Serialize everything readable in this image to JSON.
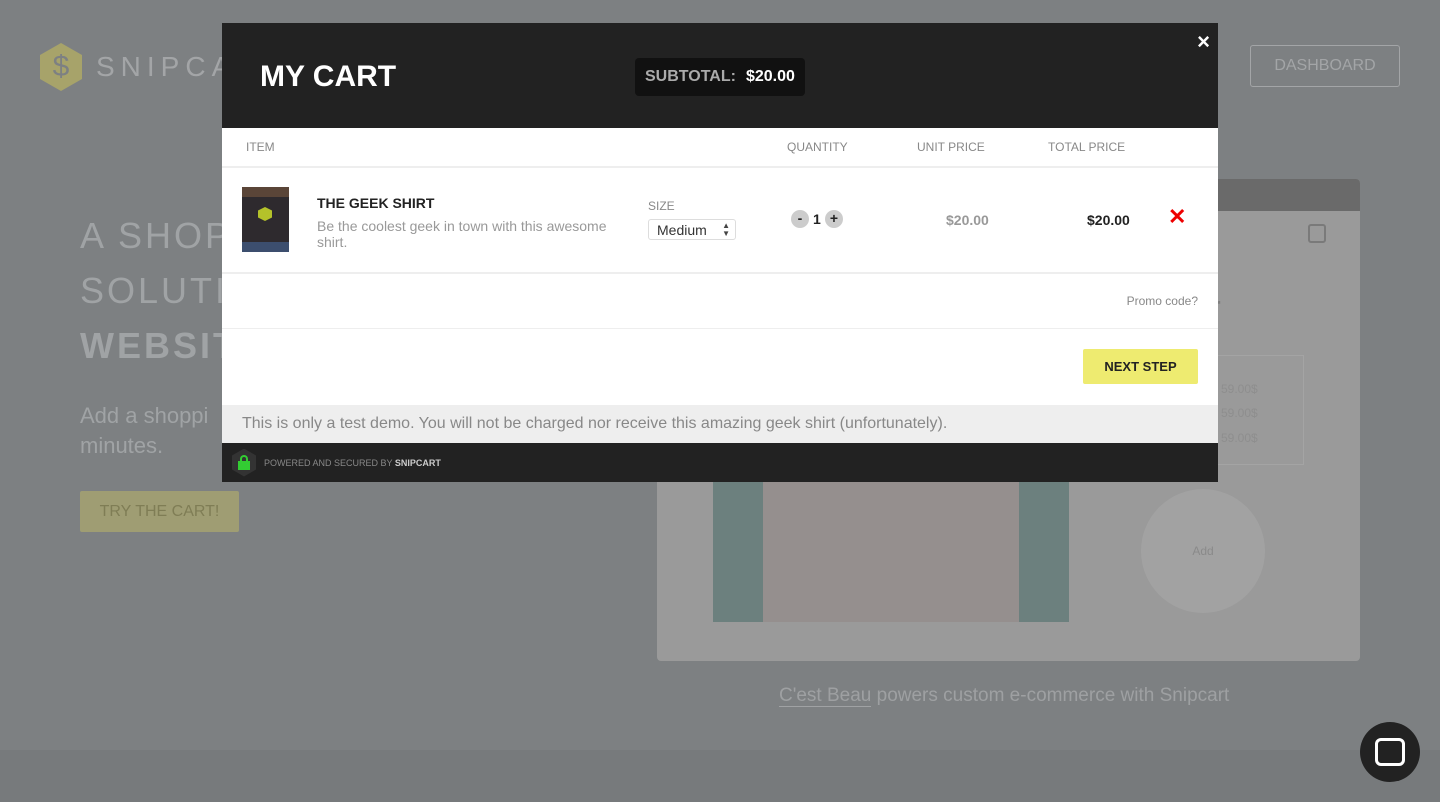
{
  "background": {
    "logo_text": "SNIPCA",
    "dashboard": "DASHBOARD",
    "hero": [
      "A SHOP",
      "SOLUTIO",
      "WEBSIT"
    ],
    "sub": [
      "Add a shoppi",
      "minutes."
    ],
    "try_button": "TRY THE CART!",
    "prices": [
      "59.00$",
      "59.00$",
      "59.00$"
    ],
    "add": "Add",
    "fragment": "r",
    "caption_link": "C'est Beau",
    "caption_rest": " powers custom e-commerce with Snipcart"
  },
  "cart": {
    "title": "MY CART",
    "subtotal_label": "SUBTOTAL:",
    "subtotal_value": "$20.00",
    "close": "×",
    "columns": {
      "item": "ITEM",
      "quantity": "QUANTITY",
      "unit_price": "UNIT PRICE",
      "total_price": "TOTAL PRICE"
    },
    "items": [
      {
        "name": "THE GEEK SHIRT",
        "description": "Be the coolest geek in town with this awesome shirt.",
        "size_label": "SIZE",
        "size": "Medium",
        "quantity": "1",
        "unit_price": "$20.00",
        "total_price": "$20.00"
      }
    ],
    "minus": "-",
    "plus": "+",
    "remove": "✕",
    "promo": "Promo code?",
    "next_step": "NEXT STEP",
    "notice": "This is only a test demo. You will not be charged nor receive this amazing geek shirt (unfortunately).",
    "footer_prefix": "POWERED AND SECURED BY ",
    "footer_brand": "SNIPCART"
  },
  "colors": {
    "accent": "#eeeb70",
    "remove": "#ee0000",
    "header": "#222222"
  }
}
